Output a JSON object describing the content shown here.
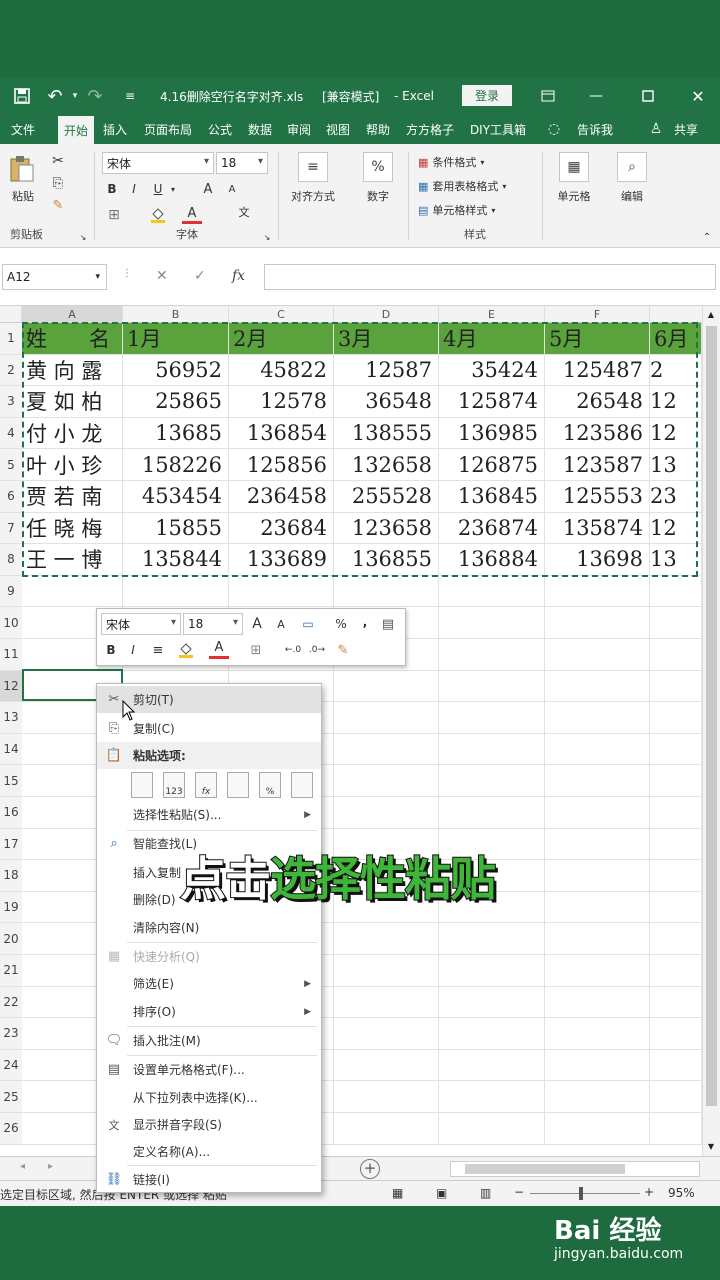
{
  "titlebar": {
    "filename": "4.16删除空行名字对齐.xls",
    "mode": "[兼容模式]",
    "app": "- Excel",
    "login": "登录",
    "undo_icon": "undo-icon",
    "save_icon": "save-icon"
  },
  "tabs": [
    "文件",
    "开始",
    "插入",
    "页面布局",
    "公式",
    "数据",
    "审阅",
    "视图",
    "帮助",
    "方方格子",
    "DIY工具箱"
  ],
  "tell_me": "告诉我",
  "share": "共享",
  "ribbon": {
    "clipboard": {
      "paste": "粘贴",
      "label": "剪贴板"
    },
    "font": {
      "name": "宋体",
      "size": "18",
      "label": "字体",
      "bold": "B",
      "italic": "I",
      "underline": "U",
      "grow": "A",
      "shrink": "A",
      "wen": "文"
    },
    "align": {
      "label": "对齐方式"
    },
    "number": {
      "label": "数字",
      "pct": "%"
    },
    "styles": {
      "cond": "条件格式",
      "table": "套用表格格式",
      "cell": "单元格样式",
      "label": "样式"
    },
    "cells": {
      "label": "单元格"
    },
    "edit": {
      "label": "编辑"
    }
  },
  "formula": {
    "namebox": "A12",
    "fx": "fx"
  },
  "columns": [
    "A",
    "B",
    "C",
    "D",
    "E",
    "F"
  ],
  "rows": [
    "1",
    "2",
    "3",
    "4",
    "5",
    "6",
    "7",
    "8",
    "9",
    "10",
    "11",
    "12",
    "13",
    "14",
    "15",
    "16",
    "17",
    "18",
    "19",
    "20",
    "21",
    "22",
    "23",
    "24",
    "25",
    "26"
  ],
  "table": {
    "header": [
      "姓　　名",
      "1月",
      "2月",
      "3月",
      "4月",
      "5月",
      "6月"
    ],
    "data": [
      [
        "黄 向 露",
        "56952",
        "45822",
        "12587",
        "35424",
        "125487",
        "2"
      ],
      [
        "夏 如 柏",
        "25865",
        "12578",
        "36548",
        "125874",
        "26548",
        "12"
      ],
      [
        "付 小 龙",
        "13685",
        "136854",
        "138555",
        "136985",
        "123586",
        "12"
      ],
      [
        "叶 小 珍",
        "158226",
        "125856",
        "132658",
        "126875",
        "123587",
        "13"
      ],
      [
        "贾 若 南",
        "453454",
        "236458",
        "255528",
        "136845",
        "125553",
        "23"
      ],
      [
        "任 晓 梅",
        "15855",
        "23684",
        "123658",
        "236874",
        "135874",
        "12"
      ],
      [
        "王 一 博",
        "135844",
        "133689",
        "136855",
        "136884",
        "13698",
        "13"
      ]
    ]
  },
  "minitoolbar": {
    "font": "宋体",
    "size": "18",
    "pct": "%",
    "comma": ",",
    "bold": "B",
    "italic": "I"
  },
  "context_menu": {
    "items": [
      {
        "label": "剪切(T)",
        "icon": "scissors-icon"
      },
      {
        "label": "复制(C)",
        "icon": "copy-icon"
      },
      {
        "label": "粘贴选项:",
        "icon": "paste-icon"
      },
      {
        "label": "选择性粘贴(S)...",
        "icon": ""
      },
      {
        "label": "智能查找(L)",
        "icon": "search-icon"
      },
      {
        "label": "插入复制",
        "icon": ""
      },
      {
        "label": "删除(D)",
        "icon": ""
      },
      {
        "label": "清除内容(N)",
        "icon": ""
      },
      {
        "label": "快速分析(Q)",
        "icon": "quick-analysis-icon"
      },
      {
        "label": "筛选(E)",
        "icon": ""
      },
      {
        "label": "排序(O)",
        "icon": ""
      },
      {
        "label": "插入批注(M)",
        "icon": "comment-icon"
      },
      {
        "label": "设置单元格格式(F)...",
        "icon": "format-cells-icon"
      },
      {
        "label": "从下拉列表中选择(K)...",
        "icon": ""
      },
      {
        "label": "显示拼音字段(S)",
        "icon": "phonetic-icon"
      },
      {
        "label": "定义名称(A)...",
        "icon": ""
      },
      {
        "label": "链接(I)",
        "icon": "link-icon"
      }
    ],
    "paste_options": [
      "",
      "123",
      "fx",
      "",
      "%",
      ""
    ]
  },
  "overlay": {
    "part1": "点击",
    "part2": "选择性粘贴"
  },
  "status": {
    "text": "选定目标区域, 然后按 ENTER 或选择 粘贴",
    "zoom": "95%"
  },
  "watermark": {
    "brand": "Bai 经验",
    "url": "jingyan.baidu.com"
  },
  "colors": {
    "excel_green": "#217346",
    "header_fill": "#5aa23c"
  }
}
